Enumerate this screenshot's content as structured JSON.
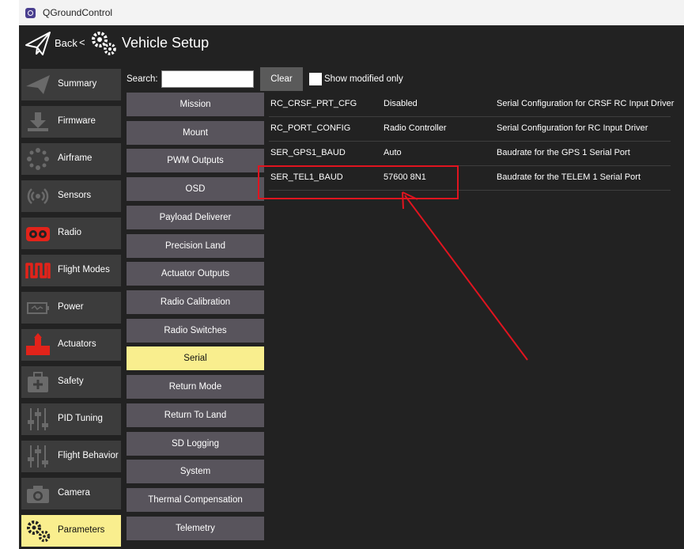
{
  "window": {
    "title": "QGroundControl"
  },
  "toolbar": {
    "back_label": "Back",
    "separator": "<",
    "title": "Vehicle Setup"
  },
  "sidebar": {
    "items": [
      {
        "label": "Summary",
        "icon": "plane-icon"
      },
      {
        "label": "Firmware",
        "icon": "download-icon"
      },
      {
        "label": "Airframe",
        "icon": "airframe-icon"
      },
      {
        "label": "Sensors",
        "icon": "sensors-icon"
      },
      {
        "label": "Radio",
        "icon": "radio-icon"
      },
      {
        "label": "Flight Modes",
        "icon": "flight-modes-icon"
      },
      {
        "label": "Power",
        "icon": "battery-icon"
      },
      {
        "label": "Actuators",
        "icon": "actuators-icon"
      },
      {
        "label": "Safety",
        "icon": "safety-icon"
      },
      {
        "label": "PID Tuning",
        "icon": "sliders-icon"
      },
      {
        "label": "Flight Behavior",
        "icon": "sliders-icon"
      },
      {
        "label": "Camera",
        "icon": "camera-icon"
      },
      {
        "label": "Parameters",
        "icon": "gears-icon",
        "active": true
      }
    ]
  },
  "search": {
    "label": "Search:",
    "value": "",
    "clear_label": "Clear",
    "show_modified_label": "Show modified only"
  },
  "groups": [
    {
      "label": "Mission"
    },
    {
      "label": "Mount"
    },
    {
      "label": "PWM Outputs"
    },
    {
      "label": "OSD"
    },
    {
      "label": "Payload Deliverer"
    },
    {
      "label": "Precision Land"
    },
    {
      "label": "Actuator Outputs"
    },
    {
      "label": "Radio Calibration"
    },
    {
      "label": "Radio Switches"
    },
    {
      "label": "Serial",
      "active": true
    },
    {
      "label": "Return Mode"
    },
    {
      "label": "Return To Land"
    },
    {
      "label": "SD Logging"
    },
    {
      "label": "System"
    },
    {
      "label": "Thermal Compensation"
    },
    {
      "label": "Telemetry"
    }
  ],
  "params": [
    {
      "name": "RC_CRSF_PRT_CFG",
      "value": "Disabled",
      "description": "Serial Configuration for CRSF RC Input Driver"
    },
    {
      "name": "RC_PORT_CONFIG",
      "value": "Radio Controller",
      "description": "Serial Configuration for RC Input Driver"
    },
    {
      "name": "SER_GPS1_BAUD",
      "value": "Auto",
      "description": "Baudrate for the GPS 1 Serial Port"
    },
    {
      "name": "SER_TEL1_BAUD",
      "value": "57600 8N1",
      "description": "Baudrate for the TELEM 1 Serial Port"
    }
  ],
  "colors": {
    "active": "#f9ee8e",
    "annotation": "#e0141f",
    "background": "#222222"
  }
}
